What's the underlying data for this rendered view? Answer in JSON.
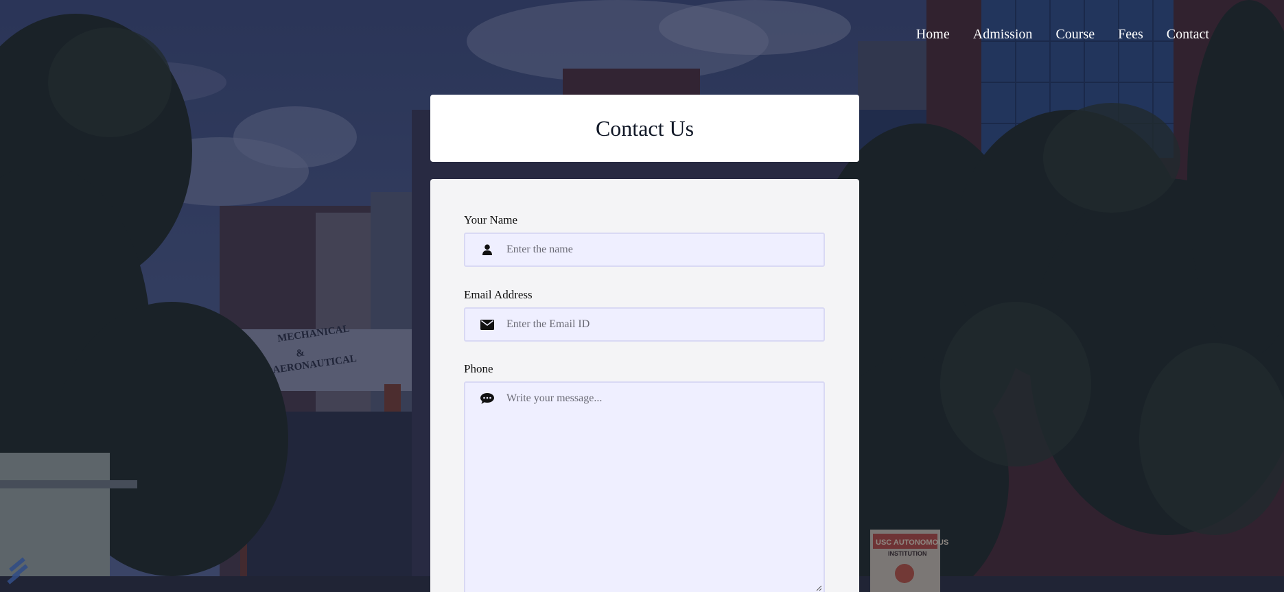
{
  "nav": {
    "items": [
      {
        "label": "Home"
      },
      {
        "label": "Admission"
      },
      {
        "label": "Course"
      },
      {
        "label": "Fees"
      },
      {
        "label": "Contact"
      }
    ]
  },
  "header": {
    "title": "Contact Us"
  },
  "form": {
    "name": {
      "label": "Your Name",
      "placeholder": "Enter the name",
      "value": "",
      "icon": "user-icon"
    },
    "email": {
      "label": "Email Address",
      "placeholder": "Enter the Email ID",
      "value": "",
      "icon": "envelope-icon"
    },
    "phone": {
      "label": "Phone",
      "placeholder": "Write your message...",
      "value": "",
      "icon": "comment-icon"
    }
  },
  "background": {
    "building_sign": "MECHANICAL & AERONAUTICAL",
    "banner_text": "USC AUTONOMOUS INSTITUTION"
  },
  "colors": {
    "overlay": "#141830",
    "card": "#ffffff",
    "form_card": "#f4f4f6",
    "input_bg": "#efefff",
    "input_border": "#d9d9f4",
    "nav_text": "#ffffff"
  }
}
